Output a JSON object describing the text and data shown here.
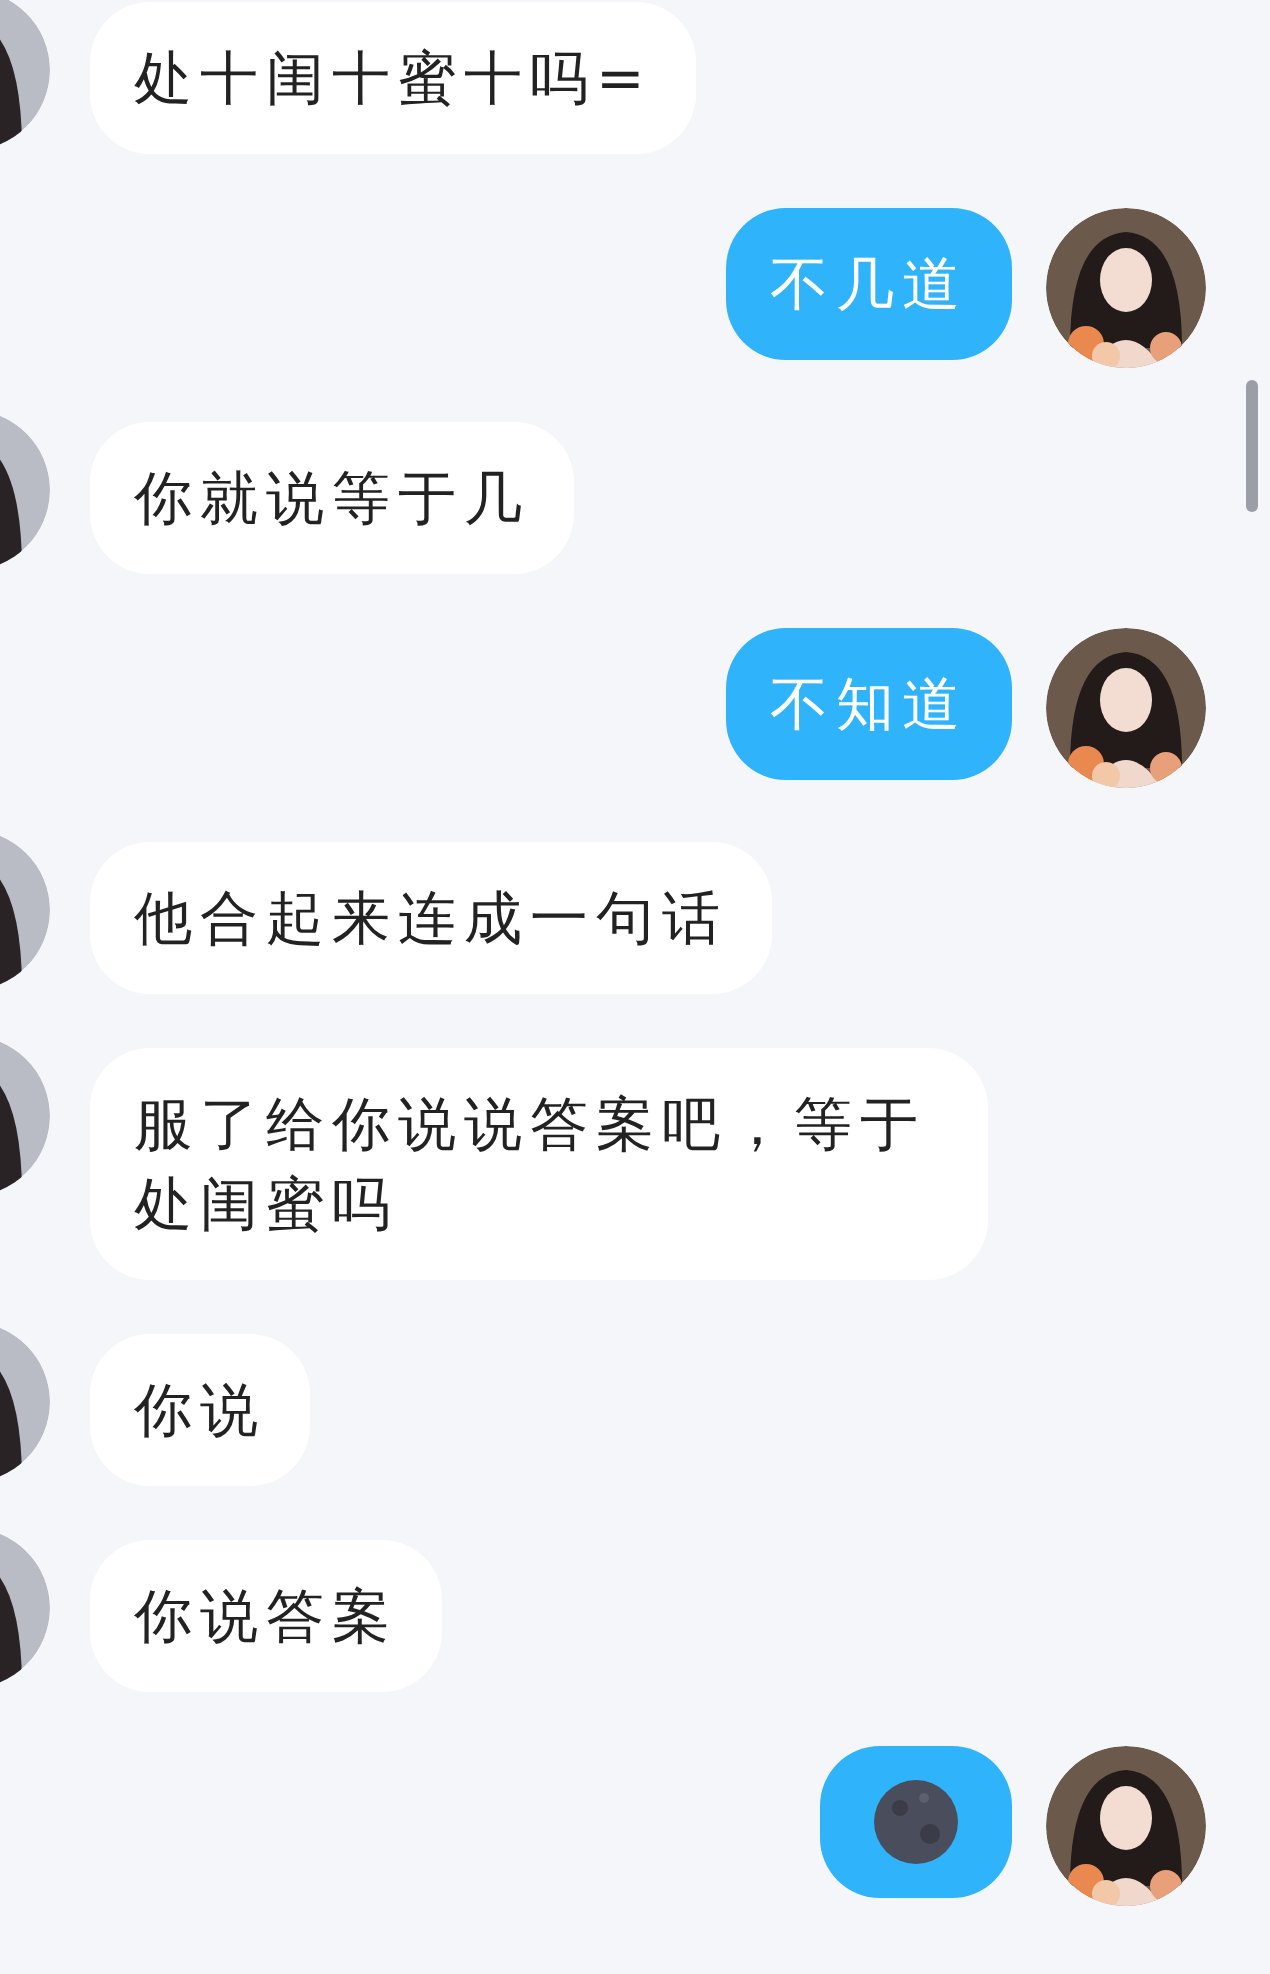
{
  "messages": [
    {
      "outgoing": false,
      "kind": "text",
      "text": "处十闺十蜜十吗="
    },
    {
      "outgoing": true,
      "kind": "text",
      "text": "不几道"
    },
    {
      "outgoing": false,
      "kind": "text",
      "text": "你就说等于几"
    },
    {
      "outgoing": true,
      "kind": "text",
      "text": "不知道"
    },
    {
      "outgoing": false,
      "kind": "text",
      "text": "他合起来连成一句话"
    },
    {
      "outgoing": false,
      "kind": "text",
      "text": "服了给你说说答案吧，等于处闺蜜吗"
    },
    {
      "outgoing": false,
      "kind": "text",
      "text": "你说"
    },
    {
      "outgoing": false,
      "kind": "text",
      "text": "你说答案"
    },
    {
      "outgoing": true,
      "kind": "emoji"
    }
  ]
}
